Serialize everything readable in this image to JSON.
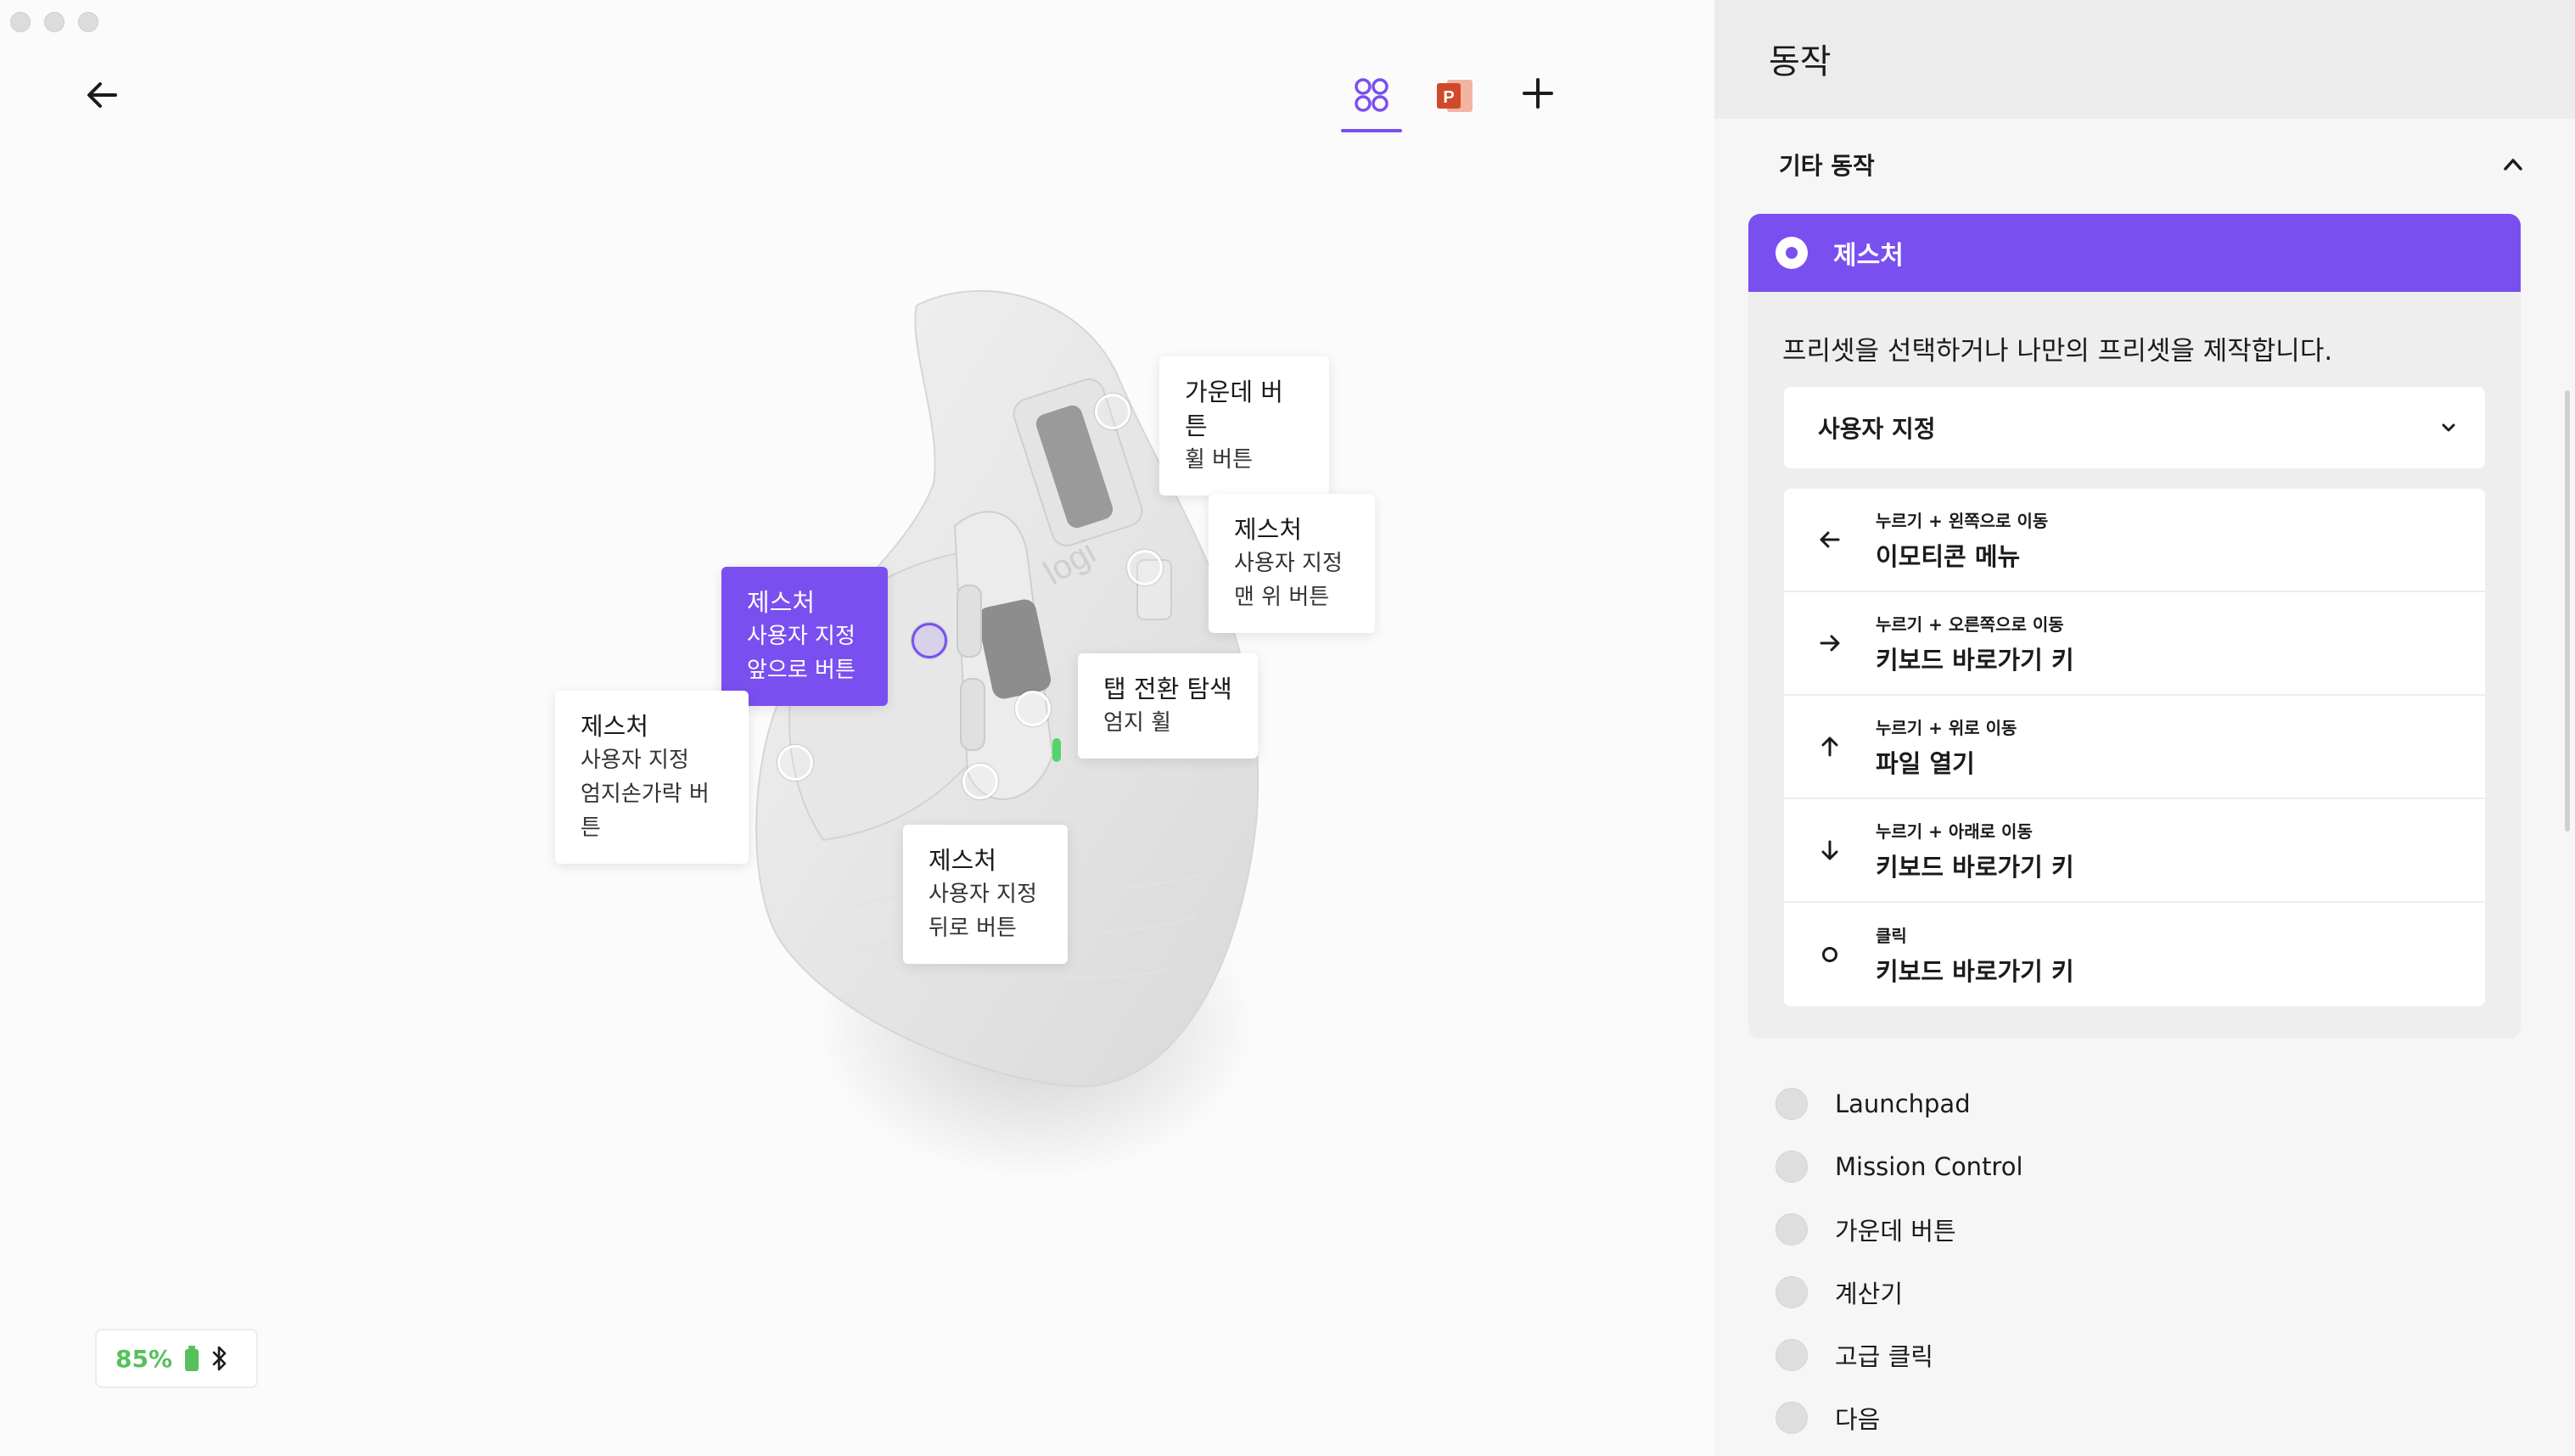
{
  "window": {
    "title": ""
  },
  "header": {
    "tabs": [
      {
        "name": "devices-grid-icon",
        "active": true
      },
      {
        "name": "powerpoint-app-icon",
        "active": false
      },
      {
        "name": "add-app-icon",
        "active": false
      }
    ],
    "add_label": "+"
  },
  "callouts": {
    "middle": {
      "title": "가운데 버튼",
      "sub": "휠 버튼"
    },
    "top": {
      "title": "제스처",
      "line2": "사용자 지정",
      "sub": "맨 위 버튼"
    },
    "forward": {
      "title": "제스처",
      "line2": "사용자 지정",
      "sub": "앞으로 버튼"
    },
    "thumbwheel": {
      "title": "탭 전환 탐색",
      "sub": "엄지 휠"
    },
    "thumb": {
      "title": "제스처",
      "line2": "사용자 지정",
      "sub": "엄지손가락 버튼"
    },
    "back": {
      "title": "제스처",
      "line2": "사용자 지정",
      "sub": "뒤로 버튼"
    }
  },
  "battery": {
    "percent": "85%",
    "color": "#55c15b"
  },
  "panel": {
    "title": "동작",
    "section": "기타 동작",
    "selected": {
      "label": "제스처",
      "description": "프리셋을 선택하거나 나만의 프리셋을 제작합니다.",
      "preset": "사용자 지정",
      "gestures": [
        {
          "icon": "arrow-left-icon",
          "hint": "누르기 + 왼쪽으로 이동",
          "action": "이모티콘 메뉴"
        },
        {
          "icon": "arrow-right-icon",
          "hint": "누르기 + 오른쪽으로 이동",
          "action": "키보드 바로가기 키"
        },
        {
          "icon": "arrow-up-icon",
          "hint": "누르기 + 위로 이동",
          "action": "파일 열기"
        },
        {
          "icon": "arrow-down-icon",
          "hint": "누르기 + 아래로 이동",
          "action": "키보드 바로가기 키"
        },
        {
          "icon": "circle-icon",
          "hint": "클릭",
          "action": "키보드 바로가기 키"
        }
      ]
    },
    "options": [
      "Launchpad",
      "Mission Control",
      "가운데 버튼",
      "계산기",
      "고급 클릭",
      "다음"
    ]
  },
  "colors": {
    "accent": "#7a4ff0",
    "battery": "#55c15b"
  }
}
